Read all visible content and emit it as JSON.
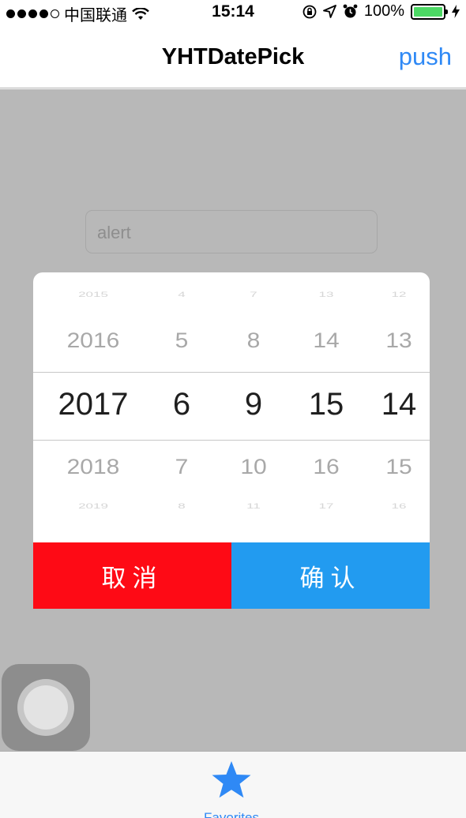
{
  "status_bar": {
    "carrier": "中国联通",
    "time": "15:14",
    "battery_percent": "100%",
    "battery_level": 1.0
  },
  "nav": {
    "title": "YHTDatePick",
    "push_label": "push"
  },
  "main": {
    "alert_placeholder": "alert"
  },
  "picker": {
    "columns": [
      [
        "2015",
        "2016",
        "2017",
        "2018",
        "2019"
      ],
      [
        "4",
        "5",
        "6",
        "7",
        "8"
      ],
      [
        "7",
        "8",
        "9",
        "10",
        "11"
      ],
      [
        "13",
        "14",
        "15",
        "16",
        "17"
      ],
      [
        "12",
        "13",
        "14",
        "15",
        "16"
      ]
    ],
    "cancel_label": "取消",
    "confirm_label": "确认"
  },
  "tabbar": {
    "items": [
      {
        "label": "Favorites",
        "icon": "star-icon"
      }
    ]
  },
  "colors": {
    "accent": "#2f89f5",
    "cancel": "#fe0a15",
    "confirm": "#229bf0",
    "battery": "#4cd964",
    "overlay": "#b8b8b8"
  }
}
